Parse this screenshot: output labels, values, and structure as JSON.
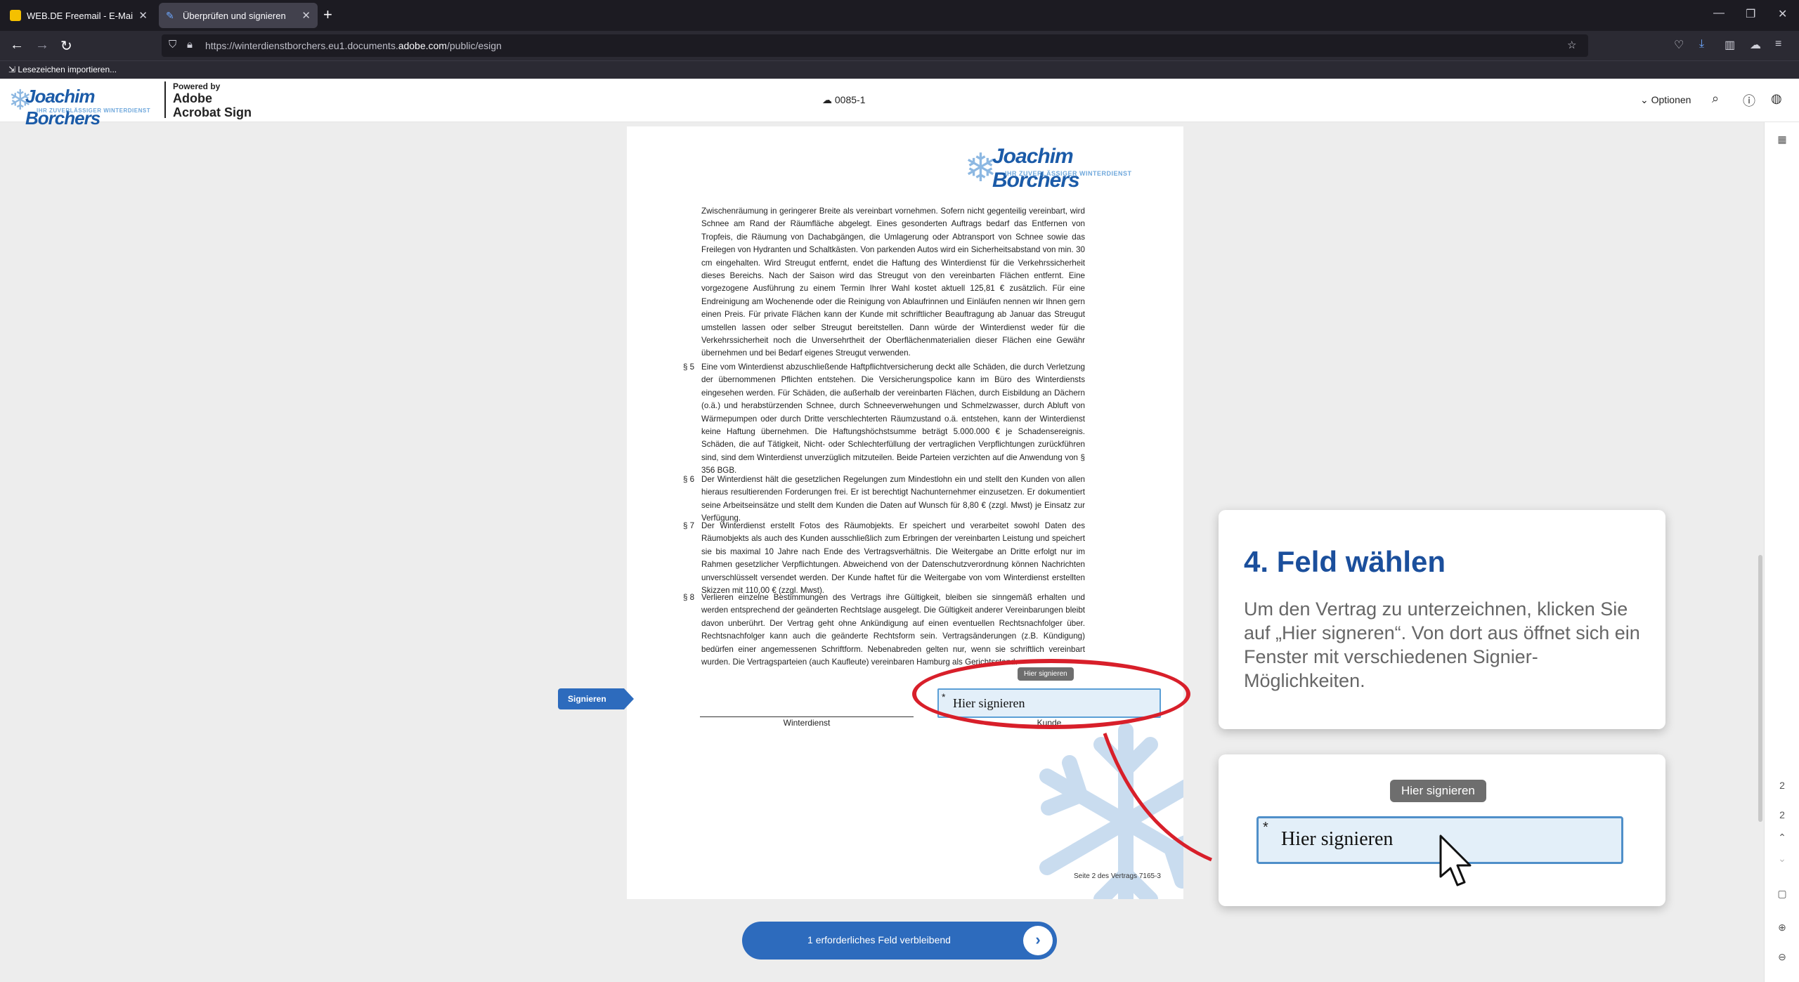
{
  "browser": {
    "tabs": [
      {
        "label": "WEB.DE Freemail - E-Mail made in Germany",
        "active": false
      },
      {
        "label": "Überprüfen und signieren",
        "active": true
      }
    ],
    "url_prefix": "https://winterdienstborchers.eu1.documents.",
    "url_domain": "adobe.com",
    "url_suffix": "/public/esign",
    "bookmarks_import": "Lesezeichen importieren..."
  },
  "header": {
    "brand": "Joachim Borchers",
    "brand_tagline": "IHR ZUVERLÄSSIGER WINTERDIENST",
    "powered_by": "Powered by",
    "product_line1": "Adobe",
    "product_line2": "Acrobat Sign",
    "document_id": "0085-1",
    "options_label": "Optionen"
  },
  "document": {
    "brand": "Joachim Borchers",
    "brand_tagline": "IHR ZUVERLÄSSIGER WINTERDIENST",
    "intro": "Zwischenräumung in geringerer Breite als vereinbart vornehmen. Sofern nicht gegenteilig vereinbart, wird Schnee am Rand der Räumfläche abgelegt. Eines gesonderten Auftrags bedarf das Entfernen von Tropfeis, die Räumung von Dachabgängen, die Umlagerung oder Abtransport von Schnee sowie das Freilegen von Hydranten und Schaltkästen. Von parkenden Autos wird ein Sicherheitsabstand von min. 30 cm eingehalten. Wird Streugut entfernt, endet die Haftung des Winterdienst für die Verkehrssicherheit dieses Bereichs. Nach der Saison wird das Streugut von den vereinbarten Flächen entfernt. Eine vorgezogene Ausführung zu einem Termin Ihrer Wahl kostet aktuell 125,81 € zusätzlich. Für eine Endreinigung am Wochenende oder die Reinigung von Ablaufrinnen und Einläufen nennen wir Ihnen gern einen Preis. Für private Flächen kann der Kunde mit schriftlicher Beauftragung ab Januar das Streugut umstellen lassen oder selber Streugut bereitstellen. Dann würde der Winterdienst weder für die Verkehrssicherheit noch die Unversehrtheit der Oberflächenmaterialien dieser Flächen eine Gewähr übernehmen und bei Bedarf eigenes Streugut verwenden.",
    "sections": [
      {
        "num": "§ 5",
        "text": "Eine vom Winterdienst abzuschließende Haftpflichtversicherung deckt alle Schäden, die durch Verletzung der übernommenen Pflichten entstehen. Die Versicherungspolice kann im Büro des Winterdiensts eingesehen werden. Für Schäden, die außerhalb der vereinbarten Flächen, durch Eisbildung an Dächern (o.ä.) und herabstürzenden Schnee, durch Schneeverwehungen und Schmelzwasser, durch Abluft von Wärmepumpen oder durch Dritte verschlechterten Räumzustand o.ä. entstehen, kann der Winterdienst keine Haftung übernehmen. Die Haftungshöchstsumme beträgt 5.000.000 € je Schadensereignis. Schäden, die auf Tätigkeit, Nicht- oder Schlechterfüllung der vertraglichen Verpflichtungen zurückführen sind, sind dem Winterdienst unverzüglich mitzuteilen. Beide Parteien verzichten auf die Anwendung von § 356 BGB."
      },
      {
        "num": "§ 6",
        "text": "Der Winterdienst hält die gesetzlichen Regelungen zum Mindestlohn ein und stellt den Kunden von allen hieraus resultierenden Forderungen frei. Er ist berechtigt Nachunternehmer einzusetzen. Er dokumentiert seine Arbeitseinsätze und stellt dem Kunden die Daten auf Wunsch für 8,80 € (zzgl. Mwst) je Einsatz zur Verfügung."
      },
      {
        "num": "§ 7",
        "text": "Der Winterdienst erstellt Fotos des Räumobjekts. Er speichert und verarbeitet sowohl Daten des Räumobjekts als auch des Kunden ausschließlich zum Erbringen der vereinbarten Leistung und speichert sie bis maximal 10 Jahre nach Ende des Vertragsverhältnis. Die Weitergabe an Dritte erfolgt nur im Rahmen gesetzlicher Verpflichtungen. Abweichend von der Datenschutzverordnung können Nachrichten unverschlüsselt versendet werden. Der Kunde haftet für die Weitergabe von vom Winterdienst erstellten Skizzen mit 110,00 € (zzgl. Mwst)."
      },
      {
        "num": "§ 8",
        "text": "Verlieren einzelne Bestimmungen des Vertrags ihre Gültigkeit, bleiben sie sinngemäß erhalten und werden entsprechend der geänderten Rechtslage ausgelegt. Die Gültigkeit anderer Vereinbarungen bleibt davon unberührt. Der Vertrag geht ohne Ankündigung auf einen eventuellen Rechtsnachfolger über. Rechtsnachfolger kann auch die geänderte Rechtsform sein. Vertragsänderungen (z.B. Kündigung) bedürfen einer angemessenen Schriftform. Nebenabreden gelten nur, wenn sie schriftlich vereinbart wurden. Die Vertragsparteien (auch Kaufleute) vereinbaren Hamburg als Gerichtsstand."
      }
    ],
    "sig_left_label": "Winterdienst",
    "sig_right_label": "Kunde",
    "sig_field_text": "Hier signieren",
    "sig_tooltip": "Hier signieren",
    "required_star": "*",
    "page_footer": "Seite 2 des Vertrags 7165-3"
  },
  "signieren_tag": "Signieren",
  "bottom_button": {
    "label": "1 erforderliches Feld verbleibend",
    "arrow": "›"
  },
  "tutorial": {
    "heading": "4. Feld wählen",
    "body": "Um den Vertrag zu unterzeichnen, klicken Sie auf „Hier signeren“. Von dort aus öffnet sich ein Fenster mit verschiedenen Signier-Möglichkeiten.",
    "zoom_tooltip": "Hier signieren",
    "zoom_field": "Hier signieren",
    "zoom_star": "*"
  },
  "rail": {
    "page_current": "2",
    "page_total": "2"
  },
  "colors": {
    "accent": "#2d6bbd",
    "highlight_red": "#d81f2a",
    "tutorial_heading": "#1b4f9c"
  }
}
